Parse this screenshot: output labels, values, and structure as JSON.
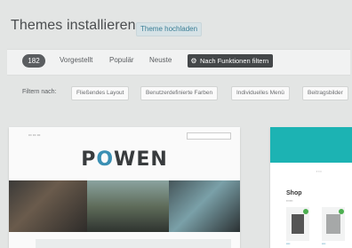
{
  "header": {
    "title": "Themes installieren",
    "upload_label": "Theme hochladen"
  },
  "filterbar": {
    "count": "182",
    "tabs": [
      "Vorgestellt",
      "Populär",
      "Neuste"
    ],
    "feature_filter_label": "Nach Funktionen filtern",
    "feature_filter_icon": "gear-icon"
  },
  "subfilter": {
    "label": "Filtern nach:",
    "chips": [
      "Fließendes Layout",
      "Benutzerdefinierte Farben",
      "Individuelles Menü",
      "Beitragsbilder"
    ]
  },
  "themes": [
    {
      "logo_text": "POWEN"
    },
    {
      "section_title": "Shop"
    }
  ],
  "colors": {
    "accent": "#3a8fb3",
    "teal": "#1cb3b3",
    "dark_button": "#444749"
  }
}
